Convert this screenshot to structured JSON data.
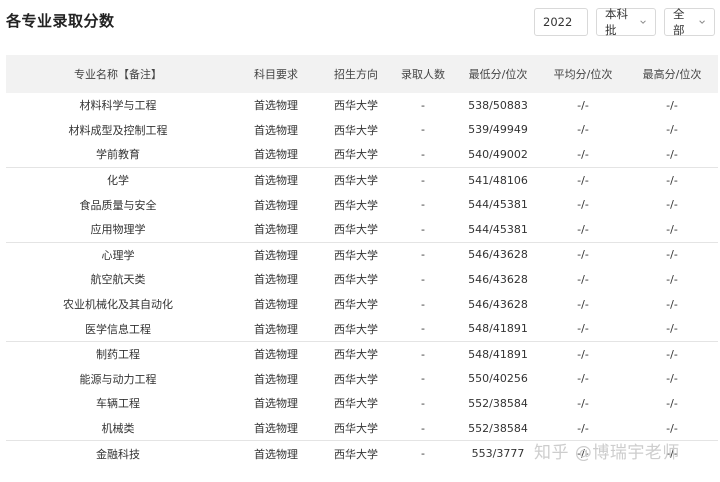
{
  "page": {
    "title": "各专业录取分数",
    "watermark": "知乎 @博瑞宇老师"
  },
  "filters": {
    "year": "2022",
    "batch": "本科批",
    "scope": "全部"
  },
  "table": {
    "columns": [
      "专业名称【备注】",
      "科目要求",
      "招生方向",
      "录取人数",
      "最低分/位次",
      "平均分/位次",
      "最高分/位次"
    ],
    "rows": [
      [
        "材料科学与工程",
        "首选物理",
        "西华大学",
        "-",
        "538/50883",
        "-/-",
        "-/-"
      ],
      [
        "材料成型及控制工程",
        "首选物理",
        "西华大学",
        "-",
        "539/49949",
        "-/-",
        "-/-"
      ],
      [
        "学前教育",
        "首选物理",
        "西华大学",
        "-",
        "540/49002",
        "-/-",
        "-/-"
      ],
      [
        "化学",
        "首选物理",
        "西华大学",
        "-",
        "541/48106",
        "-/-",
        "-/-"
      ],
      [
        "食品质量与安全",
        "首选物理",
        "西华大学",
        "-",
        "544/45381",
        "-/-",
        "-/-"
      ],
      [
        "应用物理学",
        "首选物理",
        "西华大学",
        "-",
        "544/45381",
        "-/-",
        "-/-"
      ],
      [
        "心理学",
        "首选物理",
        "西华大学",
        "-",
        "546/43628",
        "-/-",
        "-/-"
      ],
      [
        "航空航天类",
        "首选物理",
        "西华大学",
        "-",
        "546/43628",
        "-/-",
        "-/-"
      ],
      [
        "农业机械化及其自动化",
        "首选物理",
        "西华大学",
        "-",
        "546/43628",
        "-/-",
        "-/-"
      ],
      [
        "医学信息工程",
        "首选物理",
        "西华大学",
        "-",
        "548/41891",
        "-/-",
        "-/-"
      ],
      [
        "制药工程",
        "首选物理",
        "西华大学",
        "-",
        "548/41891",
        "-/-",
        "-/-"
      ],
      [
        "能源与动力工程",
        "首选物理",
        "西华大学",
        "-",
        "550/40256",
        "-/-",
        "-/-"
      ],
      [
        "车辆工程",
        "首选物理",
        "西华大学",
        "-",
        "552/38584",
        "-/-",
        "-/-"
      ],
      [
        "机械类",
        "首选物理",
        "西华大学",
        "-",
        "552/38584",
        "-/-",
        "-/-"
      ],
      [
        "金融科技",
        "首选物理",
        "西华大学",
        "-",
        "553/3777",
        "-/-",
        "-/-"
      ]
    ]
  }
}
